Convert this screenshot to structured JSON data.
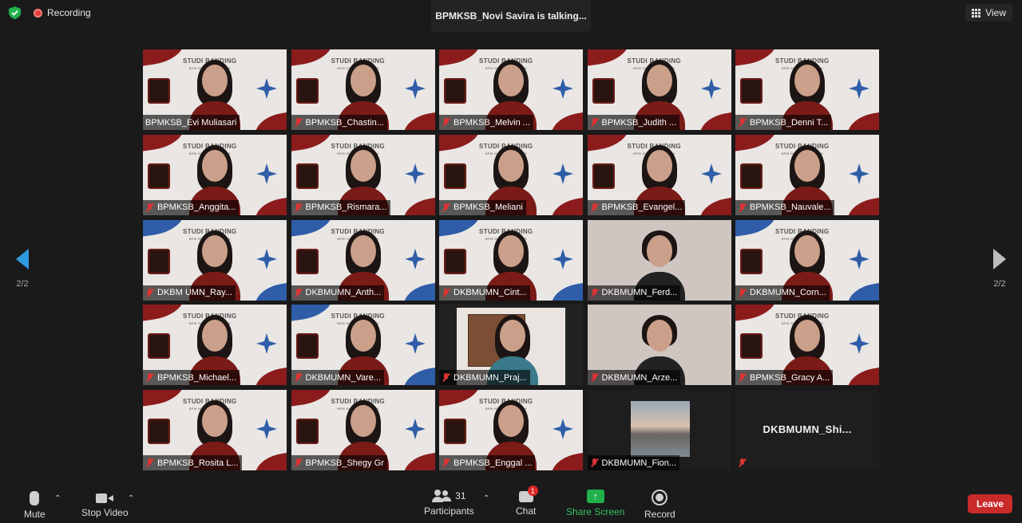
{
  "header": {
    "recording_label": "Recording",
    "talking_label": "BPMKSB_Novi Savira is talking...",
    "view_label": "View"
  },
  "paging": {
    "prev_label": "2/2",
    "next_label": "2/2"
  },
  "participants": [
    {
      "name": "BPMKSB_Evi Muliasari",
      "muted": false,
      "bg": "banner"
    },
    {
      "name": "BPMKSB_Chastin...",
      "muted": true,
      "bg": "banner"
    },
    {
      "name": "BPMKSB_Melvin ...",
      "muted": true,
      "bg": "banner"
    },
    {
      "name": "BPMKSB_Judith ...",
      "muted": true,
      "bg": "banner"
    },
    {
      "name": "BPMKSB_Denni T...",
      "muted": true,
      "bg": "banner"
    },
    {
      "name": "BPMKSB_Anggita...",
      "muted": true,
      "bg": "banner"
    },
    {
      "name": "BPMKSB_Rismara...",
      "muted": true,
      "bg": "banner"
    },
    {
      "name": "BPMKSB_Meliani",
      "muted": true,
      "bg": "banner"
    },
    {
      "name": "BPMKSB_Evangel...",
      "muted": true,
      "bg": "banner"
    },
    {
      "name": "BPMKSB_Nauvale...",
      "muted": true,
      "bg": "banner"
    },
    {
      "name": "DKBM UMN_Ray...",
      "muted": true,
      "bg": "banner-blue"
    },
    {
      "name": "DKBMUMN_Anth...",
      "muted": true,
      "bg": "banner-blue"
    },
    {
      "name": "DKBMUMN_Cint...",
      "muted": true,
      "bg": "banner-blue"
    },
    {
      "name": "DKBMUMN_Ferd...",
      "muted": true,
      "bg": "plain"
    },
    {
      "name": "DKBMUMN_Corn...",
      "muted": true,
      "bg": "banner-blue"
    },
    {
      "name": "BPMKSB_Michael...",
      "muted": true,
      "bg": "banner"
    },
    {
      "name": "DKBMUMN_Vare...",
      "muted": true,
      "bg": "banner-blue"
    },
    {
      "name": "DKBMUMN_Praj...",
      "muted": true,
      "bg": "room"
    },
    {
      "name": "DKBMUMN_Arze...",
      "muted": true,
      "bg": "plain"
    },
    {
      "name": "BPMKSB_Gracy A...",
      "muted": true,
      "bg": "banner"
    },
    {
      "name": "BPMKSB_Rosita L...",
      "muted": true,
      "bg": "banner"
    },
    {
      "name": "BPMKSB_Shegy Gr",
      "muted": true,
      "bg": "banner"
    },
    {
      "name": "BPMKSB_Enggal ...",
      "muted": true,
      "bg": "banner"
    },
    {
      "name": "DKBMUMN_Fion...",
      "muted": true,
      "bg": "photo"
    },
    {
      "name": "DKBMUMN_Shi...",
      "muted": true,
      "bg": "blank"
    }
  ],
  "banner": {
    "title": "STUDI BANDING",
    "subtitle": "BPM IKMKB-DKBM UMN"
  },
  "toolbar": {
    "mute_label": "Mute",
    "stop_video_label": "Stop Video",
    "participants_label": "Participants",
    "participants_count": "31",
    "chat_label": "Chat",
    "chat_badge": "1",
    "share_label": "Share Screen",
    "record_label": "Record",
    "leave_label": "Leave"
  },
  "colors": {
    "accent_blue": "#2e9ae0",
    "share_green": "#22b14c",
    "leave_red": "#c92a2a",
    "brand_red": "#8c1c1c"
  }
}
